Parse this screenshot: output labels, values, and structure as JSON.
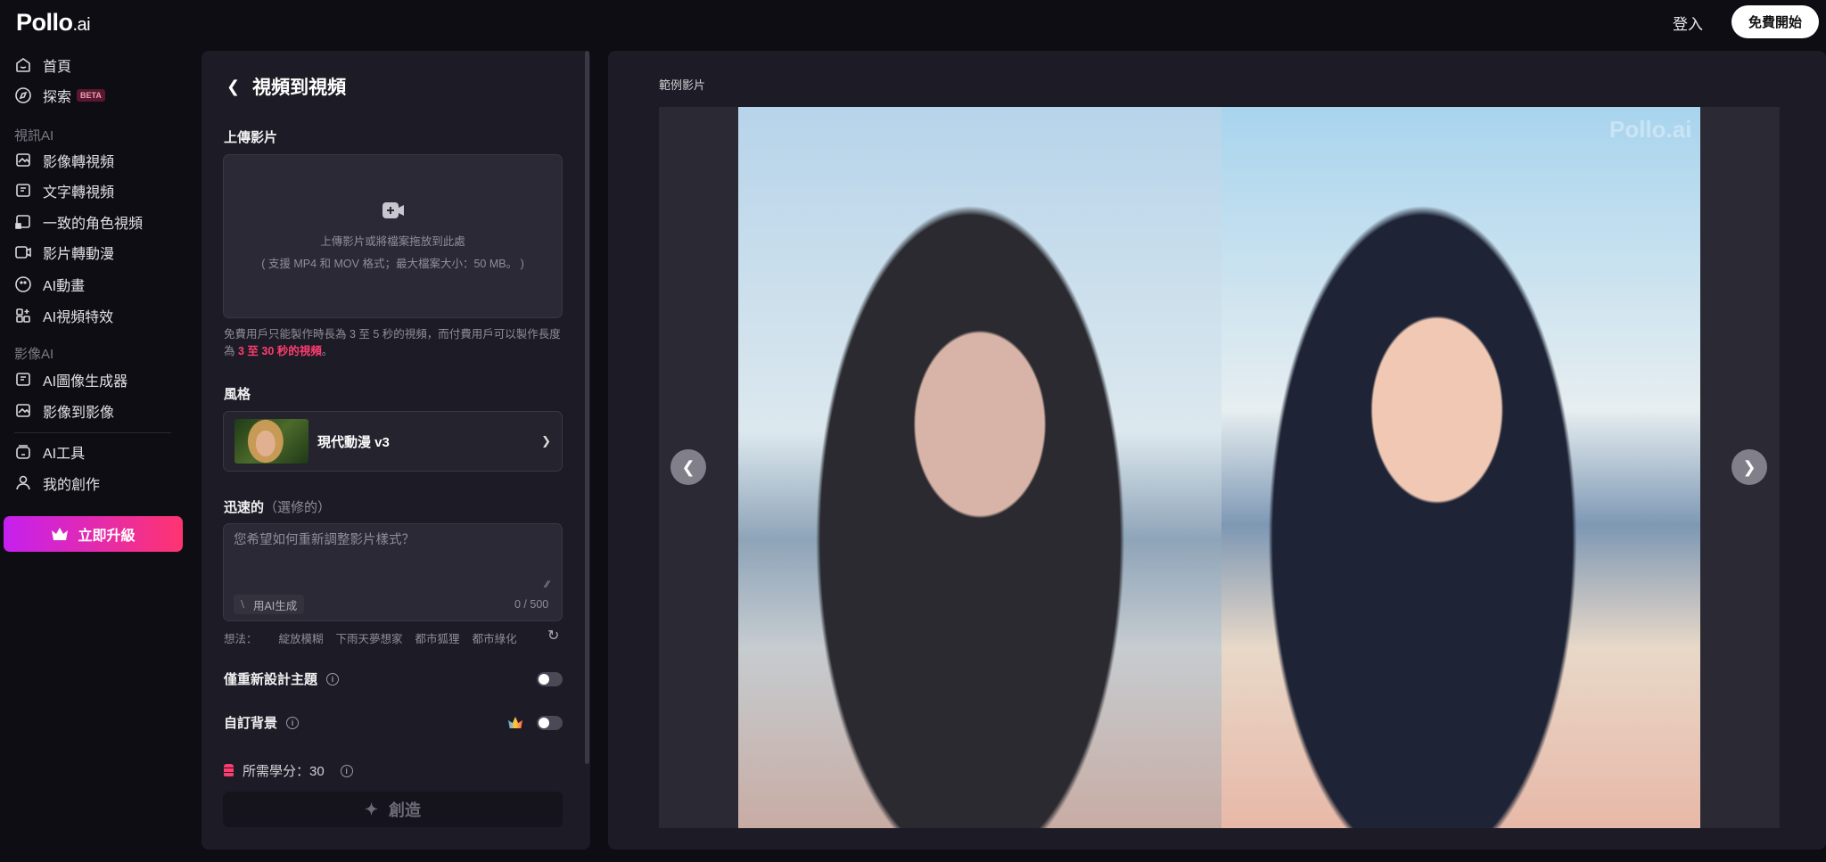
{
  "header": {
    "logo": "Pollo",
    "logo_suffix": ".ai",
    "login": "登入",
    "start": "免費開始"
  },
  "sidebar": {
    "items": [
      {
        "label": "首頁",
        "icon": "home-icon"
      },
      {
        "label": "探索",
        "icon": "compass-icon",
        "badge": "BETA"
      }
    ],
    "section_video": "視訊AI",
    "video_items": [
      {
        "label": "影像轉視頻"
      },
      {
        "label": "文字轉視頻"
      },
      {
        "label": "一致的角色視頻"
      },
      {
        "label": "影片轉動漫"
      },
      {
        "label": "AI動畫"
      },
      {
        "label": "AI視頻特效"
      }
    ],
    "section_image": "影像AI",
    "image_items": [
      {
        "label": "AI圖像生成器"
      },
      {
        "label": "影像到影像"
      }
    ],
    "bottom_items": [
      {
        "label": "AI工具"
      },
      {
        "label": "我的創作"
      }
    ],
    "upgrade": "立即升級"
  },
  "panel": {
    "title": "視頻到視頻",
    "upload_label": "上傳影片",
    "upload_text": "上傳影片或將檔案拖放到此處",
    "upload_hint": "( 支援 MP4 和 MOV 格式；最大檔案大小：50 MB。 )",
    "note_a": "免費用戶只能製作時長為 3 至 5 秒的視頻，而付費用戶可以製作長度為 ",
    "note_highlight": "3 至 30 秒的視頻",
    "note_end": "。",
    "style_label": "風格",
    "style_name": "現代動漫 v3",
    "prompt_label": "迅速的",
    "prompt_optional": "（選修的）",
    "prompt_placeholder": "您希望如何重新調整影片樣式？",
    "ai_generate": "用AI生成",
    "char_count": "0 / 500",
    "ideas_label": "想法：",
    "ideas": [
      "綻放模糊",
      "下雨天夢想家",
      "都市狐狸",
      "都市綠化"
    ],
    "toggle_subject": "僅重新設計主題",
    "toggle_subject_on": false,
    "toggle_bg": "自訂背景",
    "toggle_bg_on": false,
    "credits": "所需學分：30",
    "create": "創造"
  },
  "preview": {
    "label": "範例影片",
    "watermark": "Pollo.ai"
  },
  "colors": {
    "accent": "#ff3c6e",
    "upgrade_from": "#c520ef",
    "upgrade_to": "#ff3470"
  }
}
